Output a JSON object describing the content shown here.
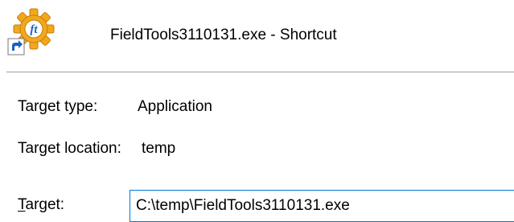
{
  "header": {
    "icon": "fieldtools-gear-shortcut-icon",
    "shortcut_name": "FieldTools3110131.exe - Shortcut"
  },
  "fields": {
    "target_type_label": "Target type:",
    "target_type_value": "Application",
    "target_location_label": "Target location:",
    "target_location_value": "temp",
    "target_label_mnemonic": "T",
    "target_label_rest": "arget:",
    "target_value": "C:\\temp\\FieldTools3110131.exe"
  },
  "colors": {
    "icon_gear": "#f2a81d",
    "icon_badge": "#1f5fbf",
    "input_border": "#0078d7",
    "divider": "#a0a0a0"
  }
}
